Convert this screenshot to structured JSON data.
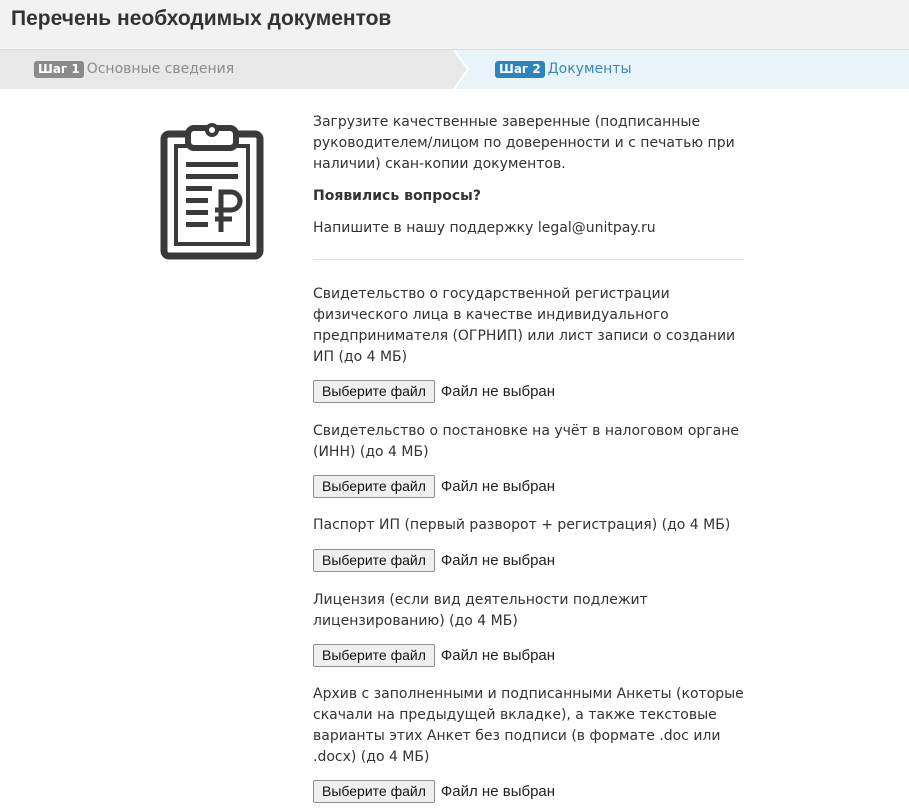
{
  "page": {
    "title": "Перечень необходимых документов"
  },
  "steps": [
    {
      "badge": "Шаг 1",
      "label": "Основные сведения",
      "state": "inactive"
    },
    {
      "badge": "Шаг 2",
      "label": "Документы",
      "state": "active"
    }
  ],
  "info": {
    "intro": "Загрузите качественные заверенные (подписанные руководителем/лицом по доверенности и с печатью при наличии) скан-копии документов.",
    "question": "Появились вопросы?",
    "support": "Напишите в нашу поддержку legal@unitpay.ru"
  },
  "documents": [
    {
      "label": "Свидетельство о государственной регистрации физического лица в качестве индивидуального предпринимателя (ОГРНИП) или лист записи о создании ИП (до 4 МБ)",
      "button": "Выберите файл",
      "status": "Файл не выбран"
    },
    {
      "label": "Свидетельство о постановке на учёт в налоговом органе (ИНН) (до 4 МБ)",
      "button": "Выберите файл",
      "status": "Файл не выбран"
    },
    {
      "label": "Паспорт ИП (первый разворот + регистрация) (до 4 МБ)",
      "button": "Выберите файл",
      "status": "Файл не выбран"
    },
    {
      "label": "Лицензия (если вид деятельности подлежит лицензированию) (до 4 МБ)",
      "button": "Выберите файл",
      "status": "Файл не выбран"
    },
    {
      "label": "Архив с заполненными и подписанными Анкеты (которые скачали на предыдущей вкладке), а также текстовые варианты этих Анкет без подписи (в формате .doc или .docx) (до 4 МБ)",
      "button": "Выберите файл",
      "status": "Файл не выбран"
    }
  ],
  "icons": {
    "illustration": "clipboard-ruble-icon"
  },
  "colors": {
    "active_step": "#2d84bd",
    "inactive_step": "#8a8a8a",
    "icon": "#3a3a3a"
  }
}
